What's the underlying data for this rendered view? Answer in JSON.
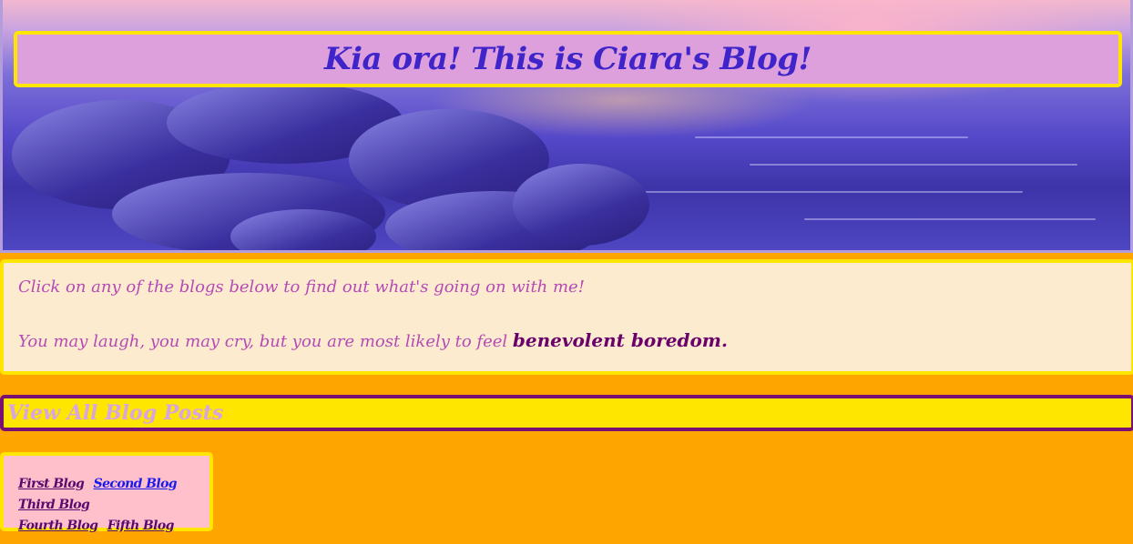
{
  "header": {
    "title": "Kia ora! This is Ciara's Blog!"
  },
  "intro": {
    "line1": "Click on any of the blogs below to find out what's going on with me!",
    "line2_prefix": "You may laugh, you may cry, but you are most likely to feel ",
    "line2_emphasis": "benevolent boredom."
  },
  "view_all": {
    "label": "View All Blog Posts"
  },
  "blogs": {
    "items": [
      {
        "label": "First Blog"
      },
      {
        "label": "Second Blog"
      },
      {
        "label": "Third Blog"
      },
      {
        "label": "Fourth Blog"
      },
      {
        "label": "Fifth Blog"
      }
    ]
  },
  "colors": {
    "page_background": "#ffa500",
    "accent_yellow": "#ffe600",
    "title_bg": "#dda0dd",
    "title_text": "#3f24c9",
    "intro_bg": "#fdebd0",
    "intro_text": "#b44bb4",
    "emphasis_text": "#6a006a",
    "links_bg": "#ffc0cb"
  }
}
